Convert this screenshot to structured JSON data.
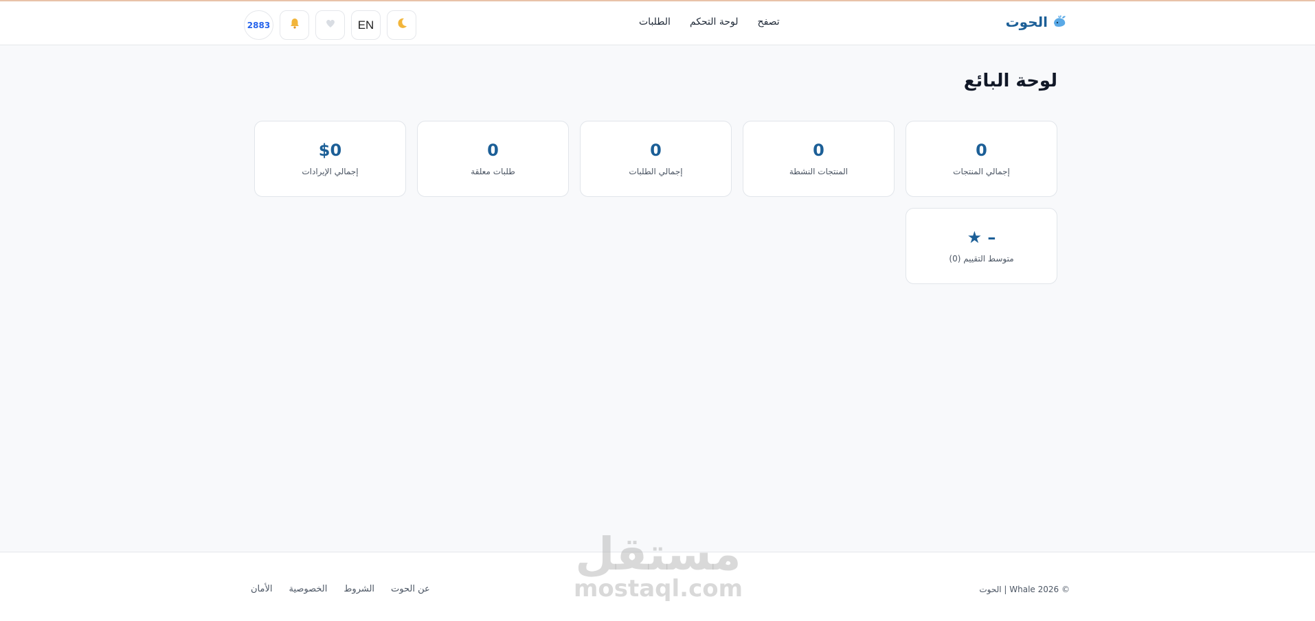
{
  "header": {
    "brand": "الحوت",
    "nav": [
      "تصفح",
      "لوحة التحكم",
      "الطلبات"
    ],
    "lang_label": "EN",
    "avatar_text": "2883"
  },
  "page_title": "لوحة البائع",
  "stats": [
    {
      "value": "0",
      "label": "إجمالي المنتجات"
    },
    {
      "value": "0",
      "label": "المنتجات النشطة"
    },
    {
      "value": "0",
      "label": "إجمالي الطلبات"
    },
    {
      "value": "0",
      "label": "طلبات معلقة"
    },
    {
      "value": "$0",
      "label": "إجمالي الإيرادات"
    },
    {
      "value": "– ★",
      "label": "متوسط التقييم (0)"
    }
  ],
  "footer": {
    "copyright": "© 2026 Whale | الحوت",
    "links": [
      "عن الحوت",
      "الشروط",
      "الخصوصية",
      "الأمان"
    ]
  },
  "watermark": {
    "ar": "مستقل",
    "en": "mostaql.com"
  },
  "colors": {
    "accent": "#1c5f97",
    "background": "#f8f9fb",
    "top_line": "#e8c2a8"
  },
  "icons": [
    "whale-icon",
    "moon-icon",
    "heart-icon",
    "bell-icon"
  ]
}
